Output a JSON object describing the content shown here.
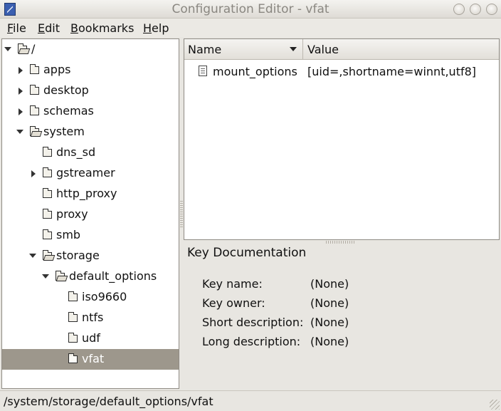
{
  "window": {
    "title": "Configuration Editor - vfat"
  },
  "menu": {
    "items": [
      {
        "underline": "F",
        "rest": "ile"
      },
      {
        "underline": "E",
        "rest": "dit"
      },
      {
        "underline": "B",
        "rest": "ookmarks"
      },
      {
        "underline": "H",
        "rest": "elp"
      }
    ]
  },
  "tree": {
    "items": [
      {
        "label": "/",
        "expanded": true
      },
      {
        "label": "apps",
        "expanded": false
      },
      {
        "label": "desktop",
        "expanded": false
      },
      {
        "label": "schemas",
        "expanded": false
      },
      {
        "label": "system",
        "expanded": true
      },
      {
        "label": "dns_sd"
      },
      {
        "label": "gstreamer",
        "expanded": false
      },
      {
        "label": "http_proxy"
      },
      {
        "label": "proxy"
      },
      {
        "label": "smb"
      },
      {
        "label": "storage",
        "expanded": true
      },
      {
        "label": "default_options",
        "expanded": true
      },
      {
        "label": "iso9660"
      },
      {
        "label": "ntfs"
      },
      {
        "label": "udf"
      },
      {
        "label": "vfat",
        "selected": true
      }
    ]
  },
  "key_list": {
    "columns": {
      "name": "Name",
      "value": "Value"
    },
    "rows": [
      {
        "name": "mount_options",
        "value": "[uid=,shortname=winnt,utf8]"
      }
    ]
  },
  "documentation": {
    "heading": "Key Documentation",
    "fields": [
      {
        "label": "Key name:",
        "value": "(None)"
      },
      {
        "label": "Key owner:",
        "value": "(None)"
      },
      {
        "label": "Short description:",
        "value": "(None)"
      },
      {
        "label": "Long description:",
        "value": "(None)"
      }
    ]
  },
  "status": {
    "path": "/system/storage/default_options/vfat"
  },
  "colors": {
    "selection": "#9d978c",
    "window_bg": "#e8e6e1"
  }
}
